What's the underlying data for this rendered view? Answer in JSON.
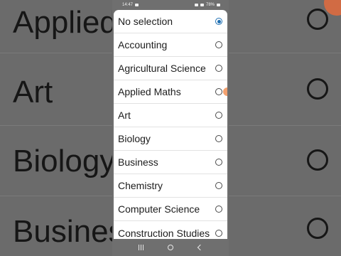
{
  "status_bar": {
    "time": "14:47",
    "battery": "78%"
  },
  "background_list": {
    "items": [
      "Applied",
      "Art",
      "Biology",
      "Busines"
    ]
  },
  "dialog": {
    "options": [
      {
        "label": "No selection",
        "selected": true
      },
      {
        "label": "Accounting",
        "selected": false
      },
      {
        "label": "Agricultural Science",
        "selected": false
      },
      {
        "label": "Applied Maths",
        "selected": false
      },
      {
        "label": "Art",
        "selected": false
      },
      {
        "label": "Biology",
        "selected": false
      },
      {
        "label": "Business",
        "selected": false
      },
      {
        "label": "Chemistry",
        "selected": false
      },
      {
        "label": "Computer Science",
        "selected": false
      },
      {
        "label": "Construction Studies",
        "selected": false
      }
    ]
  },
  "nav_bar": {
    "icons": [
      "recents-icon",
      "home-icon",
      "back-icon"
    ]
  },
  "colors": {
    "accent": "#1f6fb2",
    "dialog_bg": "#ffffff",
    "scrim": "#6f6f6f"
  }
}
